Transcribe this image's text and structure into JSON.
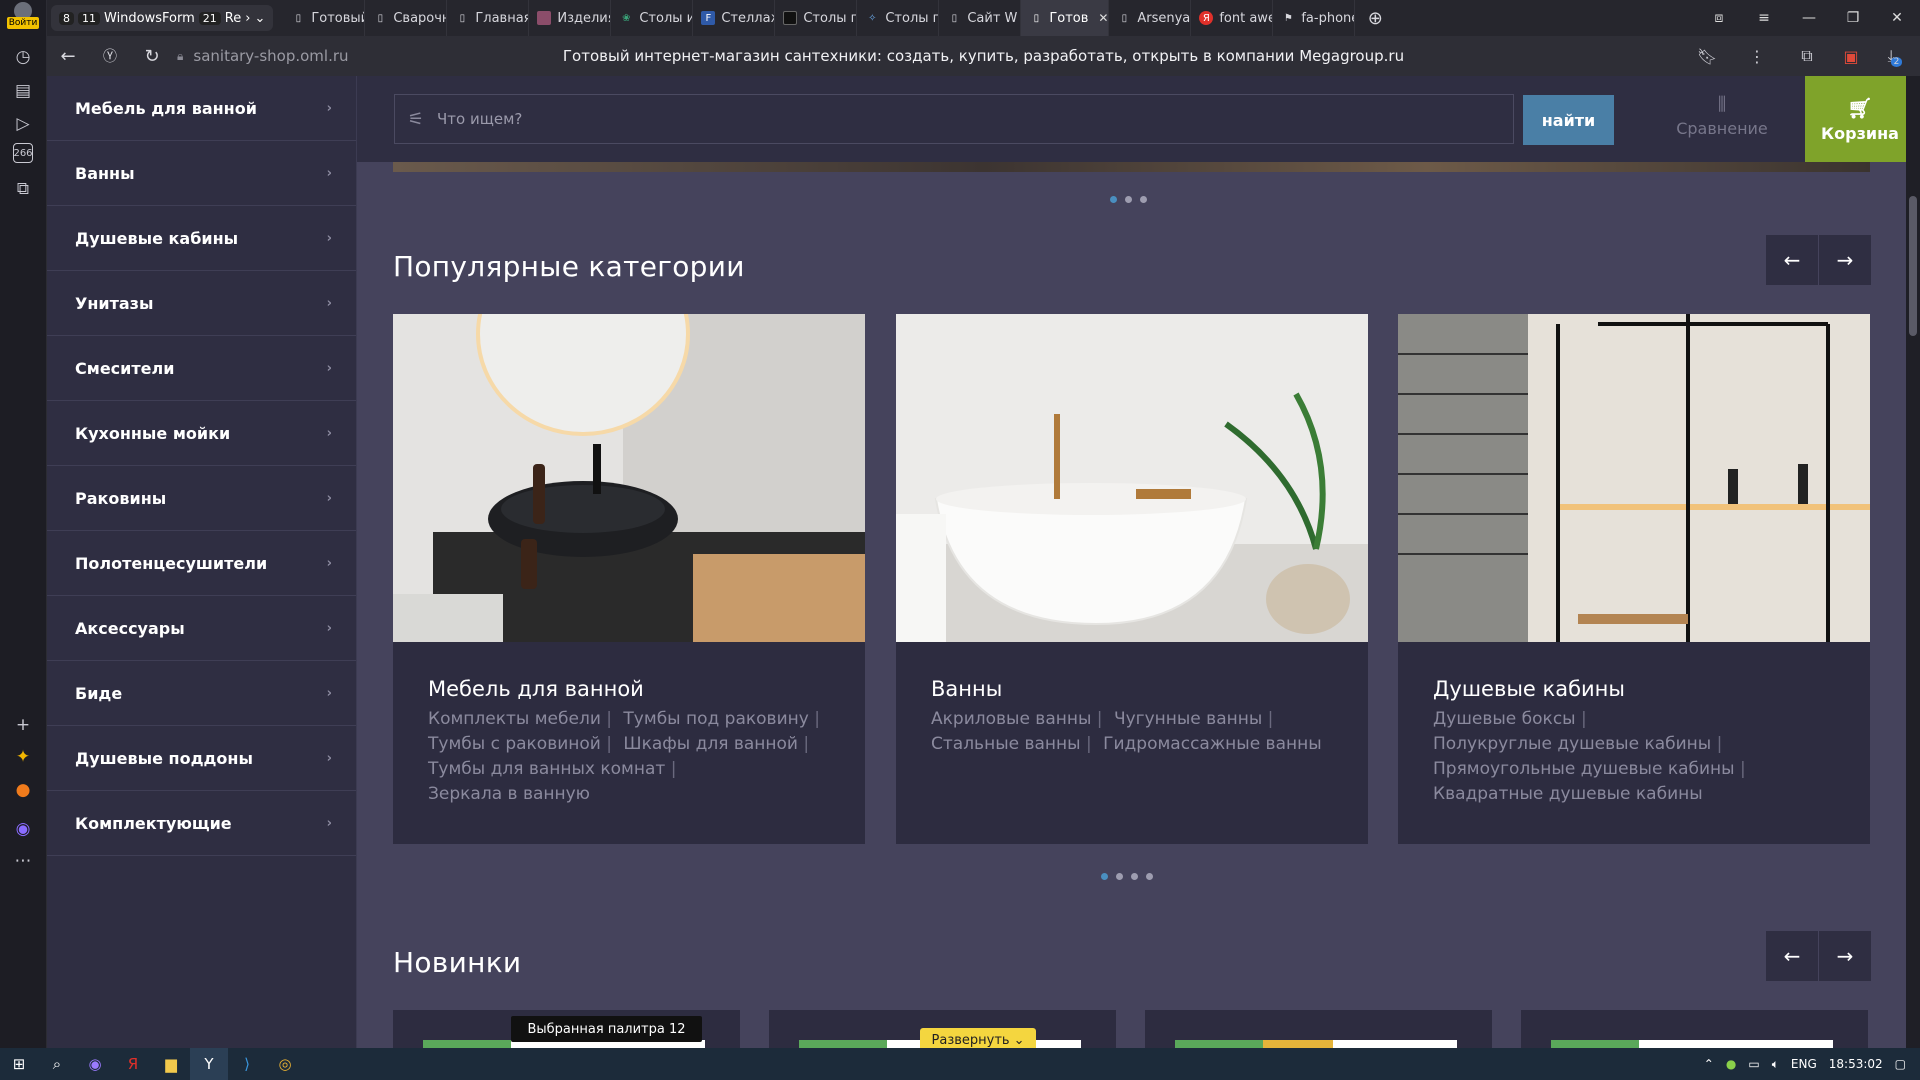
{
  "browser": {
    "login_label": "Войти",
    "group_tab": {
      "count_a": "8",
      "count_b": "11",
      "title": "WindowsForm",
      "count_c": "21",
      "suffix": "Re"
    },
    "tabs": [
      {
        "label": "Готовый",
        "icon": "page-icon"
      },
      {
        "label": "Сварочн",
        "icon": "page-icon"
      },
      {
        "label": "Главная",
        "icon": "page-icon"
      },
      {
        "label": "Изделия",
        "icon": "image-favicon"
      },
      {
        "label": "Столы и",
        "icon": "leaf-favicon"
      },
      {
        "label": "Стеллаж",
        "icon": "f-favicon"
      },
      {
        "label": "Столы пр",
        "icon": "dark-favicon"
      },
      {
        "label": "Столы п",
        "icon": "bird-favicon"
      },
      {
        "label": "Сайт W",
        "icon": "page-icon"
      },
      {
        "label": "Готов",
        "icon": "page-icon",
        "active": true
      },
      {
        "label": "Arsenya",
        "icon": "page-icon"
      },
      {
        "label": "font awe",
        "icon": "yandex-favicon"
      },
      {
        "label": "fa-phone",
        "icon": "flag-favicon"
      }
    ],
    "url": "sanitary-shop.oml.ru",
    "page_title": "Готовый интернет-магазин сантехники: создать, купить, разработать, открыть в компании Megagroup.ru",
    "download_badge": "2"
  },
  "site": {
    "sidenav": [
      "Мебель для ванной",
      "Ванны",
      "Душевые кабины",
      "Унитазы",
      "Смесители",
      "Кухонные мойки",
      "Раковины",
      "Полотенцесушители",
      "Аксессуары",
      "Биде",
      "Душевые поддоны",
      "Комплектующие"
    ],
    "search_placeholder": "Что ищем?",
    "find_button": "найти",
    "compare_label": "Сравнение",
    "cart_label": "Корзина",
    "popular_title": "Популярные категории",
    "new_title": "Новинки",
    "categories": [
      {
        "title": "Мебель для ванной",
        "subs": [
          "Комплекты мебели",
          "Тумбы под раковину",
          "Тумбы с раковиной",
          "Шкафы для ванной",
          "Тумбы для ванных комнат",
          "Зеркала в ванную"
        ]
      },
      {
        "title": "Ванны",
        "subs": [
          "Акриловые ванны",
          "Чугунные ванны",
          "Стальные ванны",
          "Гидромассажные ванны"
        ]
      },
      {
        "title": "Душевые кабины",
        "subs": [
          "Душевые боксы",
          "Полукруглые душевые кабины",
          "Прямоугольные душевые кабины",
          "Квадратные душевые кабины"
        ]
      }
    ],
    "tooltip": "Выбранная палитра 12",
    "expand_label": "Развернуть"
  },
  "taskbar": {
    "lang": "ENG",
    "time": "18:53:02"
  },
  "colors": {
    "accent_blue": "#4a7fa6",
    "cart_green": "#7fa32a",
    "site_bg": "#45435c",
    "panel_bg": "#2f2e42"
  }
}
